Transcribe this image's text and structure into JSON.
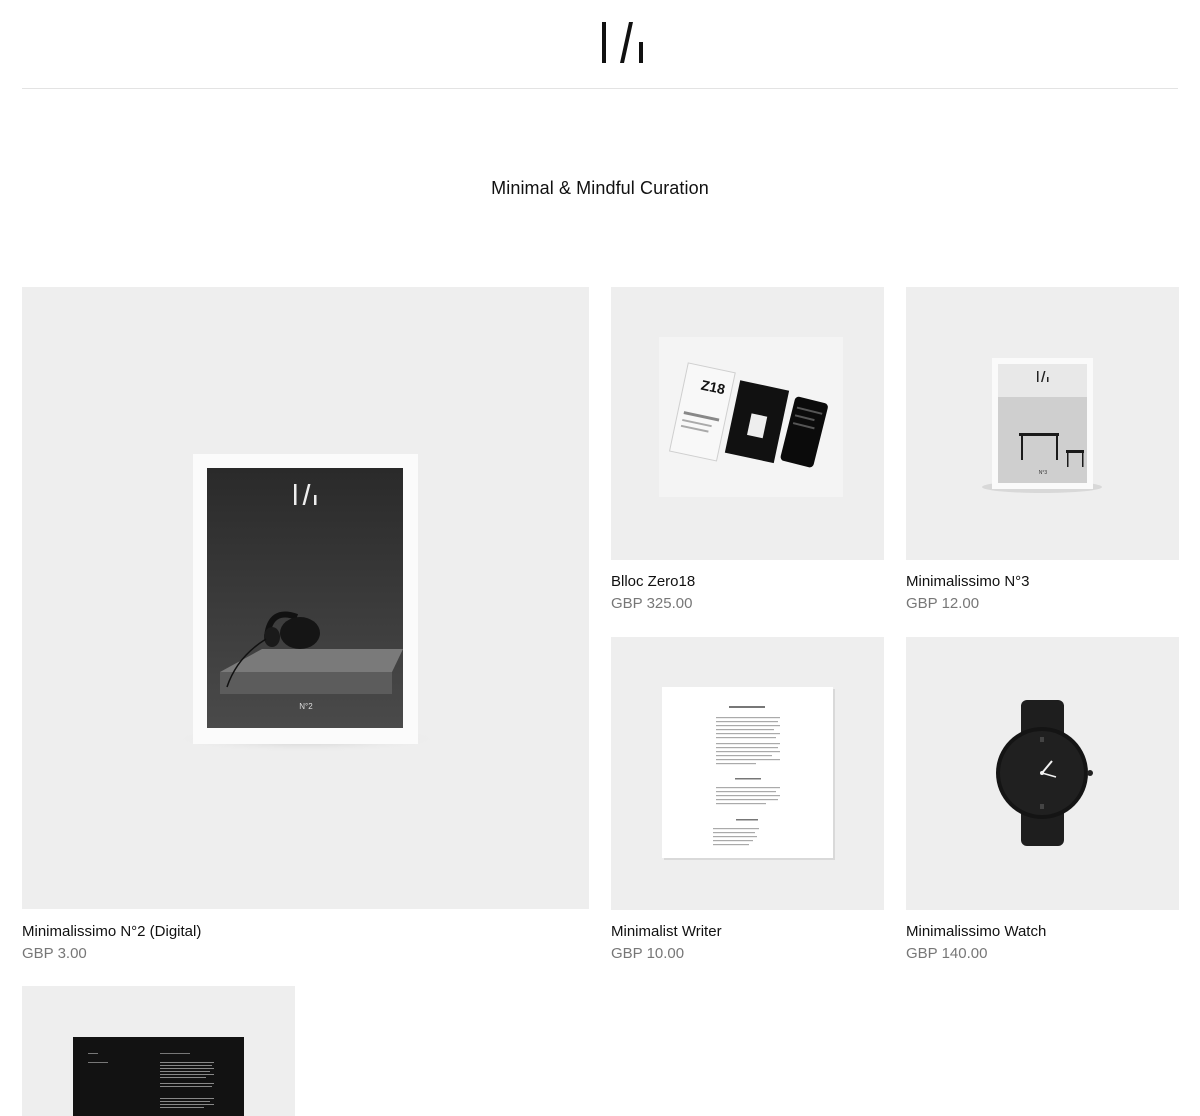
{
  "header": {
    "logo_alt": "Minimalissimo"
  },
  "tagline": "Minimal & Mindful Curation",
  "colors": {
    "tile_background": "#eeeeee",
    "text": "#111111",
    "price": "#777777",
    "divider": "#e3e3e3"
  },
  "products": [
    {
      "name": "Minimalissimo N°2 (Digital)",
      "price": "GBP 3.00",
      "image_icon": "magazine-cover-headphones"
    },
    {
      "name": "Blloc Zero18",
      "price": "GBP 325.00",
      "image_icon": "phone-box"
    },
    {
      "name": "Minimalissimo N°3",
      "price": "GBP 12.00",
      "image_icon": "magazine-cover-table"
    },
    {
      "name": "Minimalist Writer",
      "price": "GBP 10.00",
      "image_icon": "document-page"
    },
    {
      "name": "Minimalissimo Watch",
      "price": "GBP 140.00",
      "image_icon": "black-watch"
    },
    {
      "name": "",
      "price": "",
      "image_icon": "dark-document"
    }
  ],
  "covers": {
    "n2_label": "N°2",
    "n3_label": "N°3",
    "phone_box_label": "Z18"
  }
}
